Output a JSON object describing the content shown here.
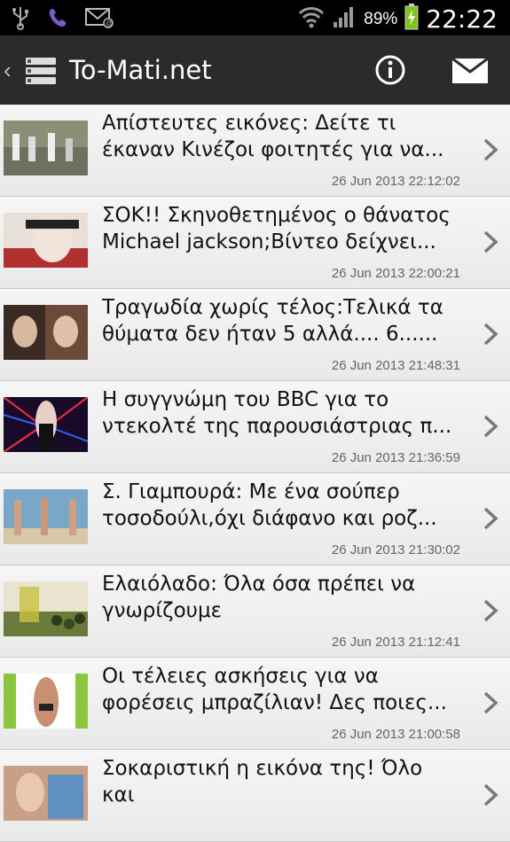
{
  "status_bar": {
    "battery_percent": "89%",
    "time": "22:22",
    "icons": [
      "usb-icon",
      "viber-icon",
      "email-notification-icon",
      "wifi-icon",
      "signal-icon",
      "battery-charging-icon"
    ]
  },
  "action_bar": {
    "title": "To-Mati.net",
    "icons": [
      "back-chevron-icon",
      "app-list-icon",
      "info-icon",
      "mail-icon"
    ]
  },
  "articles": [
    {
      "title": "Απίστευτες εικόνες: Δείτε τι\nέκαναν Κινέζοι φοιτητές για να...",
      "date": "26 Jun 2013 22:12:02",
      "thumb_color": "#8a8f78"
    },
    {
      "title": "ΣΟΚ!! Σκηνοθετημένος ο θάνατος\nMichael jackson;Βίντεο δείχνει...",
      "date": "26 Jun 2013 22:00:21",
      "thumb_color": "#b03030"
    },
    {
      "title": "Τραγωδία χωρίς τέλος:Τελικά τα\nθύματα δεν ήταν 5 αλλά.... 6......",
      "date": "26 Jun 2013 21:48:31",
      "thumb_color": "#6b4a3a"
    },
    {
      "title": "Η συγγνώμη του BBC για το\nντεκολτέ της παρουσιάστριας π...",
      "date": "26 Jun 2013 21:36:59",
      "thumb_color": "#3a1a4a"
    },
    {
      "title": "Σ. Γιαμπουρά: Με ένα σούπερ\nτοσοδούλι,όχι διάφανο και ροζ...",
      "date": "26 Jun 2013 21:30:02",
      "thumb_color": "#7aa6c8"
    },
    {
      "title": "Ελαιόλαδο: Όλα όσα πρέπει να\nγνωρίζουμε",
      "date": "26 Jun 2013 21:12:41",
      "thumb_color": "#6a7a3a"
    },
    {
      "title": "Οι τέλειες ασκήσεις για να\nφορέσεις μπραζίλιαν! Δες ποιες...",
      "date": "26 Jun 2013 21:00:58",
      "thumb_color": "#8cc63f"
    },
    {
      "title": "Σοκαριστική η εικόνα της! Όλο και\nχειροτερεύει",
      "date": "",
      "thumb_color": "#c8a088"
    }
  ]
}
